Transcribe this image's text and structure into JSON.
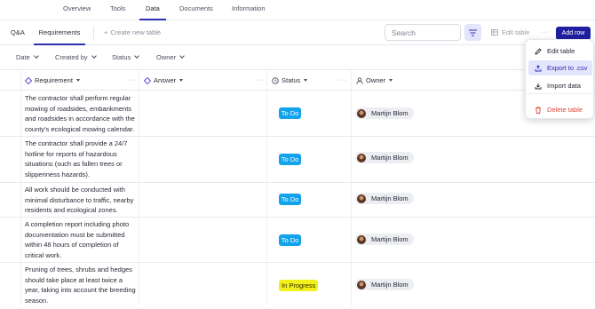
{
  "top_tabs": [
    "Overview",
    "Tools",
    "Data",
    "Documents",
    "Information"
  ],
  "sub_tabs": {
    "qa": "Q&A",
    "requirements": "Requirements"
  },
  "new_table": "Create new table",
  "search": {
    "placeholder": "Search"
  },
  "edit_table": "Edit table",
  "add_row": "Add row",
  "filters": [
    "Date",
    "Created by",
    "Status",
    "Owner"
  ],
  "columns": {
    "requirement": "Requirement",
    "answer": "Answer",
    "status": "Status",
    "owner": "Owner"
  },
  "rows": [
    {
      "requirement": "The contractor shall perform regular mowing of roadsides, embankments and roadsides in accordance with the county's ecological mowing calendar.",
      "status": "To Do",
      "owner": "Martijn Blom"
    },
    {
      "requirement": "The contractor shall provide a 24/7 hotline for reports of hazardous situations (such as fallen trees or slipperiness hazards).",
      "status": "To Do",
      "owner": "Martijn Blom"
    },
    {
      "requirement": "All work should be conducted with minimal disturbance to traffic, nearby residents and ecological zones.",
      "status": "To Do",
      "owner": "Martijn Blom"
    },
    {
      "requirement": "A completion report including photo documentation must be submitted within 48 hours of completion of critical work.",
      "status": "To Do",
      "owner": "Martijn Blom"
    },
    {
      "requirement": "Pruning of trees, shrubs and hedges should take place at least twice a year, taking into account the breeding season.",
      "status": "In Progress",
      "owner": "Martijn Blom"
    }
  ],
  "menu": {
    "edit": "Edit table",
    "export": "Export to .csv",
    "import": "Import data",
    "delete": "Delete table"
  },
  "colors": {
    "accent": "#1f1fa0",
    "todo": "#12a3ec",
    "in_progress": "#f2ef1a",
    "danger": "#e0463a"
  }
}
